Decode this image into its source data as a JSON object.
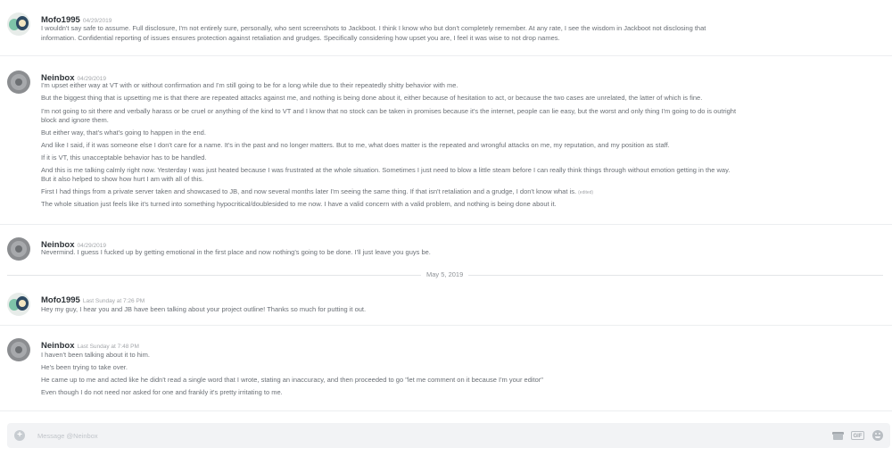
{
  "messages": [
    {
      "author": "Mofo1995",
      "timestamp": "04/29/2019",
      "avatar_icon": "mofo-avatar",
      "lines": [
        "I wouldn't say safe to assume. Full disclosure, I'm not entirely sure, personally, who sent screenshots to Jackboot. I think I know who but don't completely remember. At any rate, I see the wisdom in Jackboot not disclosing that",
        "information. Confidential reporting of issues ensures protection against retaliation and grudges. Specifically considering how upset you are, I feel it was wise to not drop names."
      ]
    },
    {
      "author": "Neinbox",
      "timestamp": "04/29/2019",
      "avatar_icon": "neinbox-avatar",
      "lines": [
        "I'm upset either way at VT with or without confirmation and I'm still going to be for a long while due to their repeatedly shitty behavior with me.",
        "But the biggest thing that is upsetting me is that there are repeated attacks against me, and nothing is being done about it, either because of hesitation to act, or because the two cases are unrelated, the latter of which is fine.",
        "I'm not going to sit there and verbally harass or be cruel or anything of the kind to VT and I know that no stock can be taken in promises because it's the internet, people can lie easy, but the worst and only thing I'm going to do is outright",
        "block and ignore them.",
        "But either way, that's what's going to happen in the end.",
        "And like I said, if it was someone else I don't care for a name. It's in the past and no longer matters. But to me, what does matter is the repeated and wrongful attacks on me, my reputation, and my position as staff.",
        "If it is VT, this unacceptable behavior has to be handled.",
        "And this is me talking calmly right now. Yesterday I was just heated because I was frustrated at the whole situation. Sometimes I just need to blow a little steam before I can really think things through without emotion getting in the way.",
        "But it also helped to show how hurt I am with all of this.",
        "First I had things from a private server taken and showcased to JB, and now several months later I'm seeing the same thing. If that isn't retaliation and a grudge, I don't know what is.",
        "The whole situation just feels like it's turned into something hypocritical/doublesided to me now. I have a valid concern with a valid problem, and nothing is being done about it."
      ],
      "edited_label": "(edited)"
    },
    {
      "author": "Neinbox",
      "timestamp": "04/29/2019",
      "avatar_icon": "neinbox-avatar",
      "lines": [
        "Nevermind. I guess I fucked up by getting emotional in the first place and now nothing's going to be done. I'll just leave you guys be."
      ]
    },
    {
      "author": "Mofo1995",
      "timestamp": "Last Sunday at 7:26 PM",
      "avatar_icon": "mofo-avatar",
      "lines": [
        "Hey my guy, I hear you and JB have been talking about your project outline! Thanks so much for putting it out."
      ]
    },
    {
      "author": "Neinbox",
      "timestamp": "Last Sunday at 7:48 PM",
      "avatar_icon": "neinbox-avatar",
      "lines": [
        "I haven't been talking about it to him.",
        "He's been trying to take over.",
        "He came up to me and acted like he didn't read a single word that I wrote, stating an inaccuracy, and then proceeded to go \"let me comment on it because I'm your editor\"",
        "Even though I do not need nor asked for one and frankly it's pretty irritating to me."
      ]
    }
  ],
  "date_divider": "May 5, 2019",
  "composer": {
    "placeholder": "Message @Neinbox",
    "icons": [
      "plus-icon",
      "gift-icon",
      "gif-icon",
      "emoji-icon"
    ],
    "gif_label": "GIF"
  },
  "colors": {
    "background": "#ffffff",
    "username": "#2e3338",
    "message_text": "#6a6f75",
    "timestamp": "#a3a6aa"
  }
}
